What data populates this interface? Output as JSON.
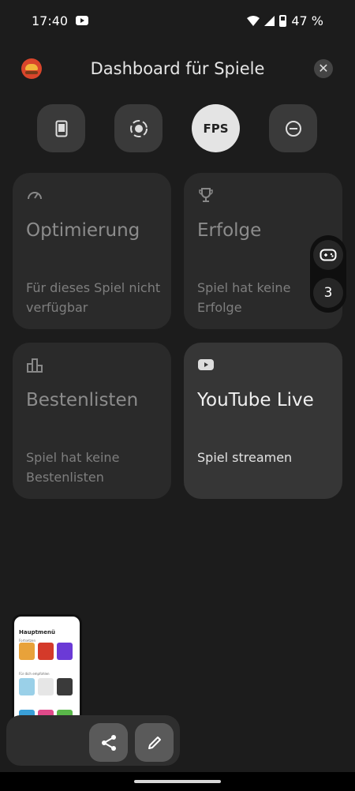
{
  "status_bar": {
    "time": "17:40",
    "battery": "47 %"
  },
  "header": {
    "title": "Dashboard für Spiele"
  },
  "quick_settings": {
    "fps_label": "FPS"
  },
  "tiles": [
    {
      "title": "Optimierung",
      "subtitle": "Für dieses Spiel nicht verfügbar",
      "icon": "speedometer-icon",
      "enabled": false
    },
    {
      "title": "Erfolge",
      "subtitle": "Spiel hat keine Erfolge",
      "icon": "trophy-icon",
      "enabled": false
    },
    {
      "title": "Bestenlisten",
      "subtitle": "Spiel hat keine Bestenlisten",
      "icon": "leaderboard-icon",
      "enabled": false
    },
    {
      "title": "YouTube Live",
      "subtitle": "Spiel streamen",
      "icon": "youtube-icon",
      "enabled": true
    }
  ],
  "side_panel": {
    "count": "3"
  },
  "thumbnail": {
    "title": "Hauptmenü",
    "section1": "Fortsetzen",
    "section2": "Für dich empfohlen"
  },
  "colors": {
    "background": "#1c1c1c",
    "tile": "#2a2a2a",
    "tile_active": "#363636"
  }
}
